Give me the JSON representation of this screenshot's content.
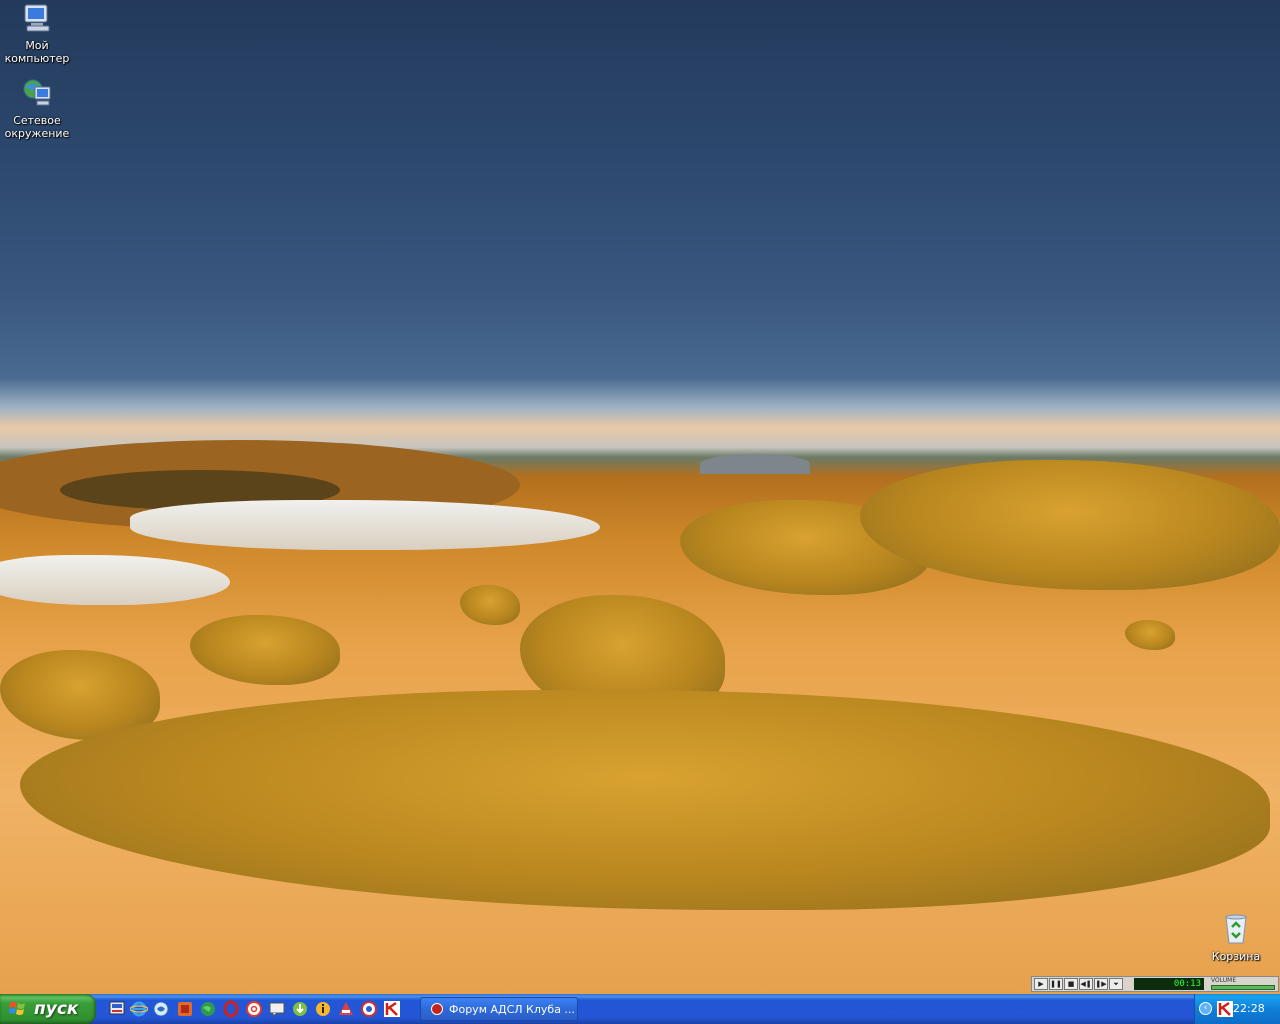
{
  "desktop": {
    "icons": [
      {
        "label": "Мой компьютер",
        "icon": "my-computer-icon"
      },
      {
        "label": "Сетевое окружение",
        "icon": "network-places-icon"
      },
      {
        "label": "Корзина",
        "icon": "recycle-bin-icon"
      }
    ]
  },
  "taskbar": {
    "start_label": "пуск",
    "quick_launch": [
      "show-desktop-icon",
      "internet-explorer-icon",
      "messenger-icon",
      "media-icon",
      "globe-icon",
      "opera-icon",
      "at-mail-icon",
      "chat-icon",
      "download-icon",
      "info-icon",
      "cleaner-icon",
      "browser-icon",
      "kaspersky-icon"
    ],
    "active_task": {
      "label": "Форум АДСЛ Клуба ...",
      "icon": "opera-icon"
    },
    "clock": "22:28"
  },
  "media_player": {
    "time": "00:13",
    "volume_label": "VOLUME",
    "buttons": [
      "play",
      "pause",
      "stop",
      "prev",
      "next",
      "eject"
    ]
  },
  "colors": {
    "taskbar": "#2555d4",
    "start": "#3c9b3c",
    "tray": "#0f7fd8"
  }
}
